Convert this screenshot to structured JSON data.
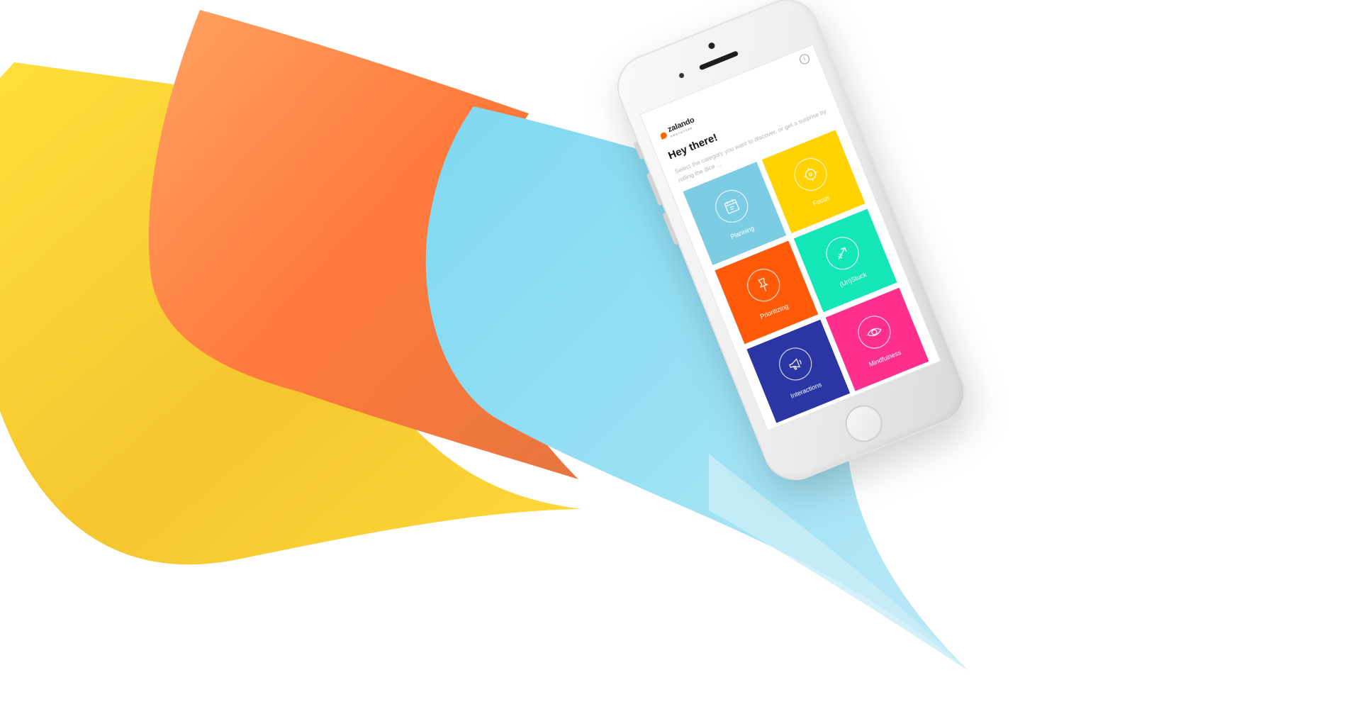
{
  "brand": {
    "name": "zalando",
    "sub": "PROTOTYPE",
    "accent": "#ff6600"
  },
  "screen": {
    "greeting": "Hey there!",
    "intro": "Select the category you want to discover, or get a surprise by rolling the dice ..."
  },
  "tiles": [
    {
      "label": "Planning",
      "color": "#7ccde4",
      "icon": "calendar-icon"
    },
    {
      "label": "Focus",
      "color": "#ffd200",
      "icon": "target-icon"
    },
    {
      "label": "Prioritizing",
      "color": "#ff5a0a",
      "icon": "pin-icon"
    },
    {
      "label": "(Un)Stuck",
      "color": "#14e6b8",
      "icon": "arrows-icon"
    },
    {
      "label": "Interactions",
      "color": "#2b35a3",
      "icon": "megaphone-icon"
    },
    {
      "label": "Mindfulness",
      "color": "#ff2f8e",
      "icon": "eye-icon"
    }
  ],
  "decor": {
    "yellow": "#ffd938",
    "orange": "#ff8a4b",
    "blue": "#8ddcf2"
  }
}
